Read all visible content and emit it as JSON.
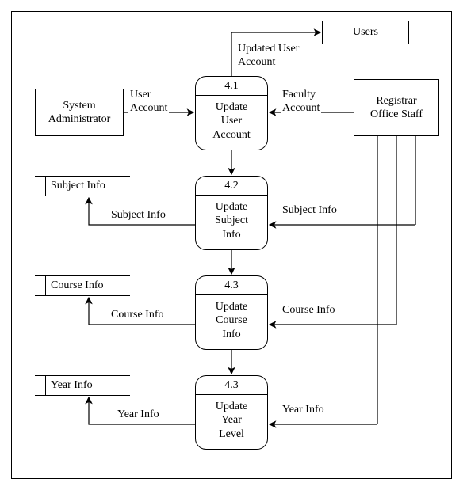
{
  "entities": {
    "sysadmin": "System\nAdministrator",
    "registrar": "Registrar\nOffice Staff",
    "users": "Users"
  },
  "datastores": {
    "subject": "Subject Info",
    "course": "Course Info",
    "year": "Year Info"
  },
  "processes": {
    "p1": {
      "num": "4.1",
      "title": "Update\nUser\nAccount"
    },
    "p2": {
      "num": "4.2",
      "title": "Update\nSubject\nInfo"
    },
    "p3": {
      "num": "4.3",
      "title": "Update\nCourse\nInfo"
    },
    "p4": {
      "num": "4.3",
      "title": "Update\nYear\nLevel"
    }
  },
  "flows": {
    "updated_user_account": "Updated User\nAccount",
    "user_account": "User\nAccount",
    "faculty_account": "Faculty\nAccount",
    "subject_info_in": "Subject Info",
    "subject_info_out": "Subject Info",
    "course_info_in": "Course Info",
    "course_info_out": "Course Info",
    "year_info_in": "Year Info",
    "year_info_out": "Year Info"
  },
  "chart_data": {
    "type": "diagram",
    "notation": "data-flow-diagram-level-2",
    "external_entities": [
      "System Administrator",
      "Registrar Office Staff",
      "Users"
    ],
    "data_stores": [
      "Subject Info",
      "Course Info",
      "Year Info"
    ],
    "processes": [
      {
        "id": "4.1",
        "name": "Update User Account"
      },
      {
        "id": "4.2",
        "name": "Update Subject Info"
      },
      {
        "id": "4.3",
        "name": "Update Course Info"
      },
      {
        "id": "4.3",
        "name": "Update Year Level"
      }
    ],
    "flows": [
      {
        "from": "System Administrator",
        "to": "4.1 Update User Account",
        "label": "User Account"
      },
      {
        "from": "Registrar Office Staff",
        "to": "4.1 Update User Account",
        "label": "Faculty Account"
      },
      {
        "from": "4.1 Update User Account",
        "to": "Users",
        "label": "Updated User Account"
      },
      {
        "from": "4.1 Update User Account",
        "to": "4.2 Update Subject Info",
        "label": ""
      },
      {
        "from": "Registrar Office Staff",
        "to": "4.2 Update Subject Info",
        "label": "Subject Info"
      },
      {
        "from": "4.2 Update Subject Info",
        "to": "Subject Info (store)",
        "label": "Subject Info"
      },
      {
        "from": "4.2 Update Subject Info",
        "to": "4.3 Update Course Info",
        "label": ""
      },
      {
        "from": "Registrar Office Staff",
        "to": "4.3 Update Course Info",
        "label": "Course Info"
      },
      {
        "from": "4.3 Update Course Info",
        "to": "Course Info (store)",
        "label": "Course Info"
      },
      {
        "from": "4.3 Update Course Info",
        "to": "4.3 Update Year Level",
        "label": ""
      },
      {
        "from": "Registrar Office Staff",
        "to": "4.3 Update Year Level",
        "label": "Year Info"
      },
      {
        "from": "4.3 Update Year Level",
        "to": "Year Info (store)",
        "label": "Year Info"
      }
    ]
  }
}
